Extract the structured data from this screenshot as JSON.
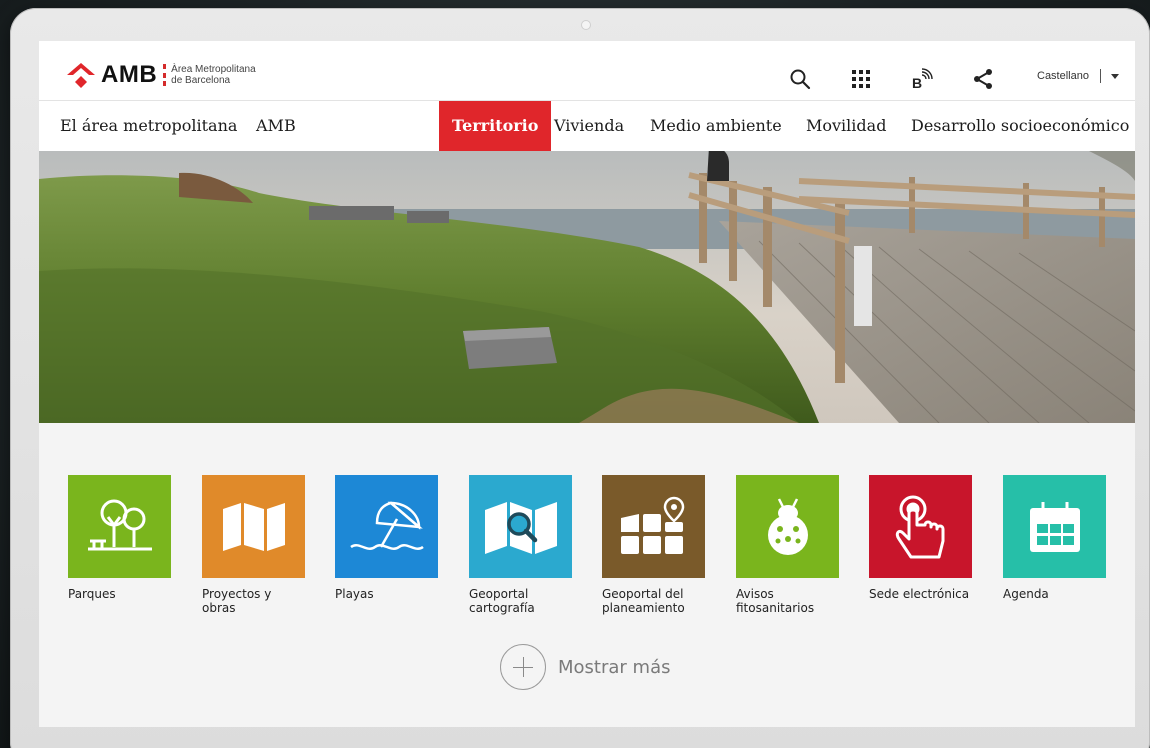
{
  "brand": {
    "name": "AMB",
    "subtitle_line1": "Àrea Metropolitana",
    "subtitle_line2": "de Barcelona",
    "color": "#e0262b"
  },
  "toolbar": {
    "icons": [
      "search-icon",
      "apps-grid-icon",
      "braille-icon",
      "share-icon"
    ],
    "language": "Castellano"
  },
  "nav": {
    "items": [
      {
        "label": "El área metropolitana",
        "active": false
      },
      {
        "label": "AMB",
        "active": false
      },
      {
        "label": "Territorio",
        "active": true
      },
      {
        "label": "Vivienda",
        "active": false
      },
      {
        "label": "Medio ambiente",
        "active": false
      },
      {
        "label": "Movilidad",
        "active": false
      },
      {
        "label": "Desarrollo socioeconómico",
        "active": false
      }
    ]
  },
  "tiles": [
    {
      "label_line1": "Parques",
      "label_line2": "",
      "color": "#7ab51d",
      "icon": "park-trees-icon"
    },
    {
      "label_line1": "Proyectos y",
      "label_line2": "obras",
      "color": "#e08a2a",
      "icon": "map-folded-icon"
    },
    {
      "label_line1": "Playas",
      "label_line2": "",
      "color": "#1d88d6",
      "icon": "beach-umbrella-icon"
    },
    {
      "label_line1": "Geoportal",
      "label_line2": "cartografía",
      "color": "#2ba9cf",
      "icon": "map-search-icon"
    },
    {
      "label_line1": "Geoportal del",
      "label_line2": "planeamiento",
      "color": "#7a5a2a",
      "icon": "plan-location-icon"
    },
    {
      "label_line1": "Avisos",
      "label_line2": "fitosanitarios",
      "color": "#7ab51d",
      "icon": "ladybug-icon"
    },
    {
      "label_line1": "Sede electrónica",
      "label_line2": "",
      "color": "#c8152b",
      "icon": "touch-hand-icon"
    },
    {
      "label_line1": "Agenda",
      "label_line2": "",
      "color": "#26bfa8",
      "icon": "calendar-icon"
    }
  ],
  "show_more": "Mostrar más"
}
